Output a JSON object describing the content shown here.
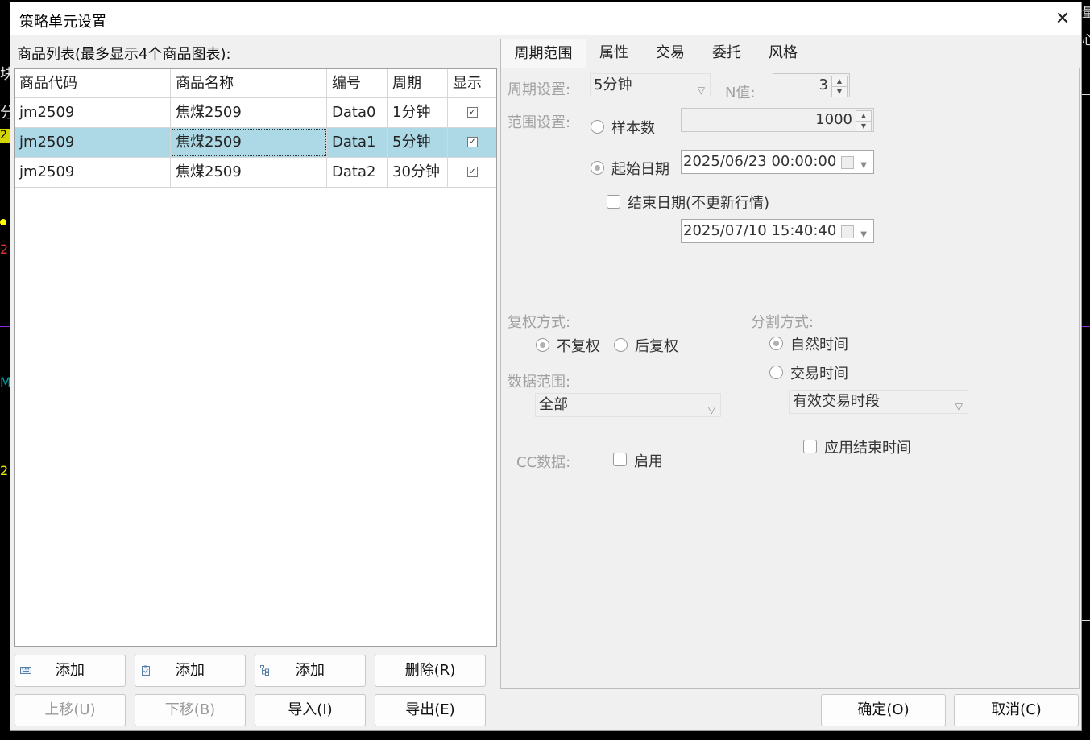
{
  "window": {
    "title": "策略单元设置",
    "close_glyph": "✕"
  },
  "list": {
    "caption": "商品列表(最多显示4个商品图表):",
    "columns": [
      "商品代码",
      "商品名称",
      "编号",
      "周期",
      "显示"
    ],
    "rows": [
      {
        "code": "jm2509",
        "name": "焦煤2509",
        "id": "Data0",
        "period": "1分钟",
        "show": true
      },
      {
        "code": "jm2509",
        "name": "焦煤2509",
        "id": "Data1",
        "period": "5分钟",
        "show": true,
        "selected": true
      },
      {
        "code": "jm2509",
        "name": "焦煤2509",
        "id": "Data2",
        "period": "30分钟",
        "show": true
      }
    ],
    "check_glyph": "✓"
  },
  "buttons": {
    "add1": "添加",
    "add2": "添加",
    "add3": "添加",
    "delete": "删除(R)",
    "up": "上移(U)",
    "down": "下移(B)",
    "import": "导入(I)",
    "export": "导出(E)",
    "ok": "确定(O)",
    "cancel": "取消(C)"
  },
  "tabs": [
    "周期范围",
    "属性",
    "交易",
    "委托",
    "风格"
  ],
  "period": {
    "period_label": "周期设置:",
    "period_value": "5分钟",
    "n_label": "N值:",
    "n_value": "3",
    "range_label": "范围设置:",
    "sample_label": "样本数",
    "sample_value": "1000",
    "start_label": "起始日期",
    "start_value": "2025/06/23 00:00:00",
    "end_label": "结束日期(不更新行情)",
    "end_value": "2025/07/10 15:40:40",
    "adjust_label": "复权方式:",
    "adjust_none": "不复权",
    "adjust_back": "后复权",
    "split_label": "分割方式:",
    "split_natural": "自然时间",
    "split_trade": "交易时间",
    "split_combo": "有效交易时段",
    "data_range_label": "数据范围:",
    "data_range_value": "全部",
    "cc_label": "CC数据:",
    "cc_enable": "启用",
    "apply_end_time": "应用结束时间"
  },
  "colors": {
    "selected_row": "#add8e6",
    "dialog_bg": "#f0f0f0",
    "disabled_text": "#a0a0a0"
  },
  "background_fragments": {
    "left_glyphs": [
      "块",
      "分",
      "2",
      "2",
      "M",
      "2"
    ],
    "right_glyphs": [
      "量",
      "心"
    ]
  }
}
